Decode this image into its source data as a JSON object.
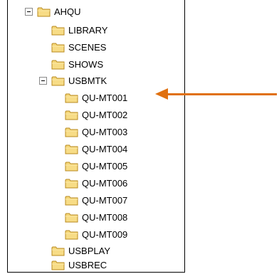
{
  "tree": {
    "root": {
      "label": "AHQU"
    },
    "root_children": [
      {
        "label": "LIBRARY"
      },
      {
        "label": "SCENES"
      },
      {
        "label": "SHOWS"
      }
    ],
    "usbmtk": {
      "label": "USBMTK"
    },
    "usbmtk_children": [
      {
        "label": "QU-MT001"
      },
      {
        "label": "QU-MT002"
      },
      {
        "label": "QU-MT003"
      },
      {
        "label": "QU-MT004"
      },
      {
        "label": "QU-MT005"
      },
      {
        "label": "QU-MT006"
      },
      {
        "label": "QU-MT007"
      },
      {
        "label": "QU-MT008"
      },
      {
        "label": "QU-MT009"
      }
    ],
    "trailing": [
      {
        "label": "USBPLAY"
      },
      {
        "label": "USBREC"
      }
    ]
  },
  "annotation": {
    "color": "#e0700f",
    "points_to": "QU-MT001"
  },
  "colors": {
    "folder_fill": "#f5d77a",
    "folder_stroke": "#b88a1e",
    "toggle_border": "#8a8a8a"
  }
}
